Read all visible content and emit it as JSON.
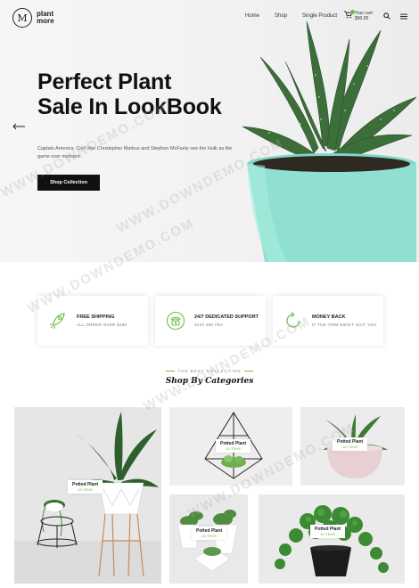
{
  "logo": {
    "mark": "M",
    "text": "plant more"
  },
  "nav": {
    "items": [
      "Home",
      "Shop",
      "Single Product"
    ]
  },
  "cart": {
    "label": "Your cart",
    "amount": "$90.00"
  },
  "hero": {
    "title_line1": "Perfect Plant",
    "title_line2": "Sale In LookBook",
    "description": "Captain America: Civil War Christopher Markus and Stephen McFeely see the Hulk as the game over moment.",
    "button": "Shop Collection"
  },
  "features": [
    {
      "title": "FREE SHIPPING",
      "subtitle": "ALL ORDER OVER $100",
      "icon": "rocket-icon"
    },
    {
      "title": "24/7 DEDICATED SUPPORT",
      "subtitle": "0123 456 TEA",
      "icon": "phone-icon"
    },
    {
      "title": "MONEY BACK",
      "subtitle": "IF THE ITEM DIDN'T SUIT YOU",
      "icon": "return-icon"
    }
  ],
  "categories": {
    "eyebrow": "THE BEST COLLECTION",
    "title": "Shop By Categories",
    "tiles": [
      {
        "name": "Potted Plant",
        "count": "16 ITEMS"
      },
      {
        "name": "Potted Plant",
        "count": "16 ITEMS"
      },
      {
        "name": "Potted Plant",
        "count": "16 ITEMS"
      },
      {
        "name": "Potted Plant",
        "count": "16 ITEMS"
      },
      {
        "name": "Potted Plant",
        "count": "16 ITEMS"
      }
    ]
  },
  "watermark": "WWW.DOWNDEMO.COM",
  "colors": {
    "accent": "#6bbe45",
    "pot": "#8fe0d2",
    "dark": "#111111"
  }
}
